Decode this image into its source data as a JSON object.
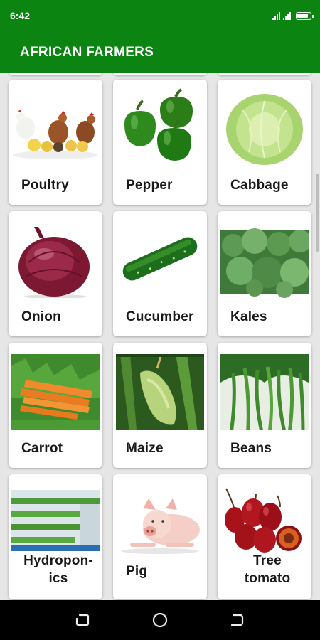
{
  "status_bar": {
    "time": "6:42"
  },
  "app_bar": {
    "title": "AFRICAN FARMERS"
  },
  "theme": {
    "primary": "#0b8412",
    "background": "#e6e6e6",
    "card": "#ffffff"
  },
  "items": [
    {
      "label": "Poultry",
      "image": "poultry-image"
    },
    {
      "label": "Pepper",
      "image": "pepper-image"
    },
    {
      "label": "Cabbage",
      "image": "cabbage-image"
    },
    {
      "label": "Onion",
      "image": "onion-image"
    },
    {
      "label": "Cucumber",
      "image": "cucumber-image"
    },
    {
      "label": "Kales",
      "image": "kales-image"
    },
    {
      "label": "Carrot",
      "image": "carrot-image"
    },
    {
      "label": "Maize",
      "image": "maize-image"
    },
    {
      "label": "Beans",
      "image": "beans-image"
    },
    {
      "label": "Hydropon- ics",
      "image": "hydroponics-image"
    },
    {
      "label": "Pig",
      "image": "pig-image"
    },
    {
      "label": "Tree tomato",
      "image": "tree-tomato-image"
    }
  ],
  "nav": {
    "recents": "recents-icon",
    "home": "home-icon",
    "back": "back-icon"
  }
}
